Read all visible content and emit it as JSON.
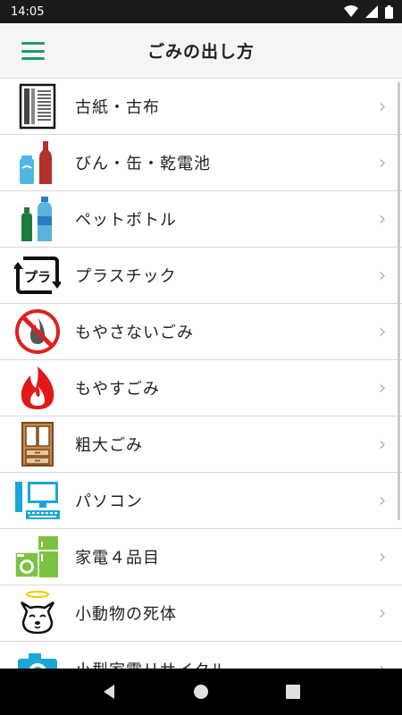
{
  "status_bar": {
    "time": "14:05"
  },
  "header": {
    "title": "ごみの出し方"
  },
  "items": [
    {
      "label": "古紙・古布",
      "icon": "newspaper-icon"
    },
    {
      "label": "びん・缶・乾電池",
      "icon": "bottle-can-icon"
    },
    {
      "label": "ペットボトル",
      "icon": "pet-bottle-icon"
    },
    {
      "label": "プラスチック",
      "icon": "plastic-recycle-icon"
    },
    {
      "label": "もやさないごみ",
      "icon": "no-burn-icon"
    },
    {
      "label": "もやすごみ",
      "icon": "flame-icon"
    },
    {
      "label": "粗大ごみ",
      "icon": "cabinet-icon"
    },
    {
      "label": "パソコン",
      "icon": "computer-icon"
    },
    {
      "label": "家電４品目",
      "icon": "appliance-icon"
    },
    {
      "label": "小動物の死体",
      "icon": "dog-angel-icon"
    },
    {
      "label": "小型家電リサイクル",
      "icon": "camera-icon"
    }
  ],
  "colors": {
    "accent": "#1e9a72",
    "chevron": "#b5b5b5",
    "divider": "#d9d9d9"
  }
}
